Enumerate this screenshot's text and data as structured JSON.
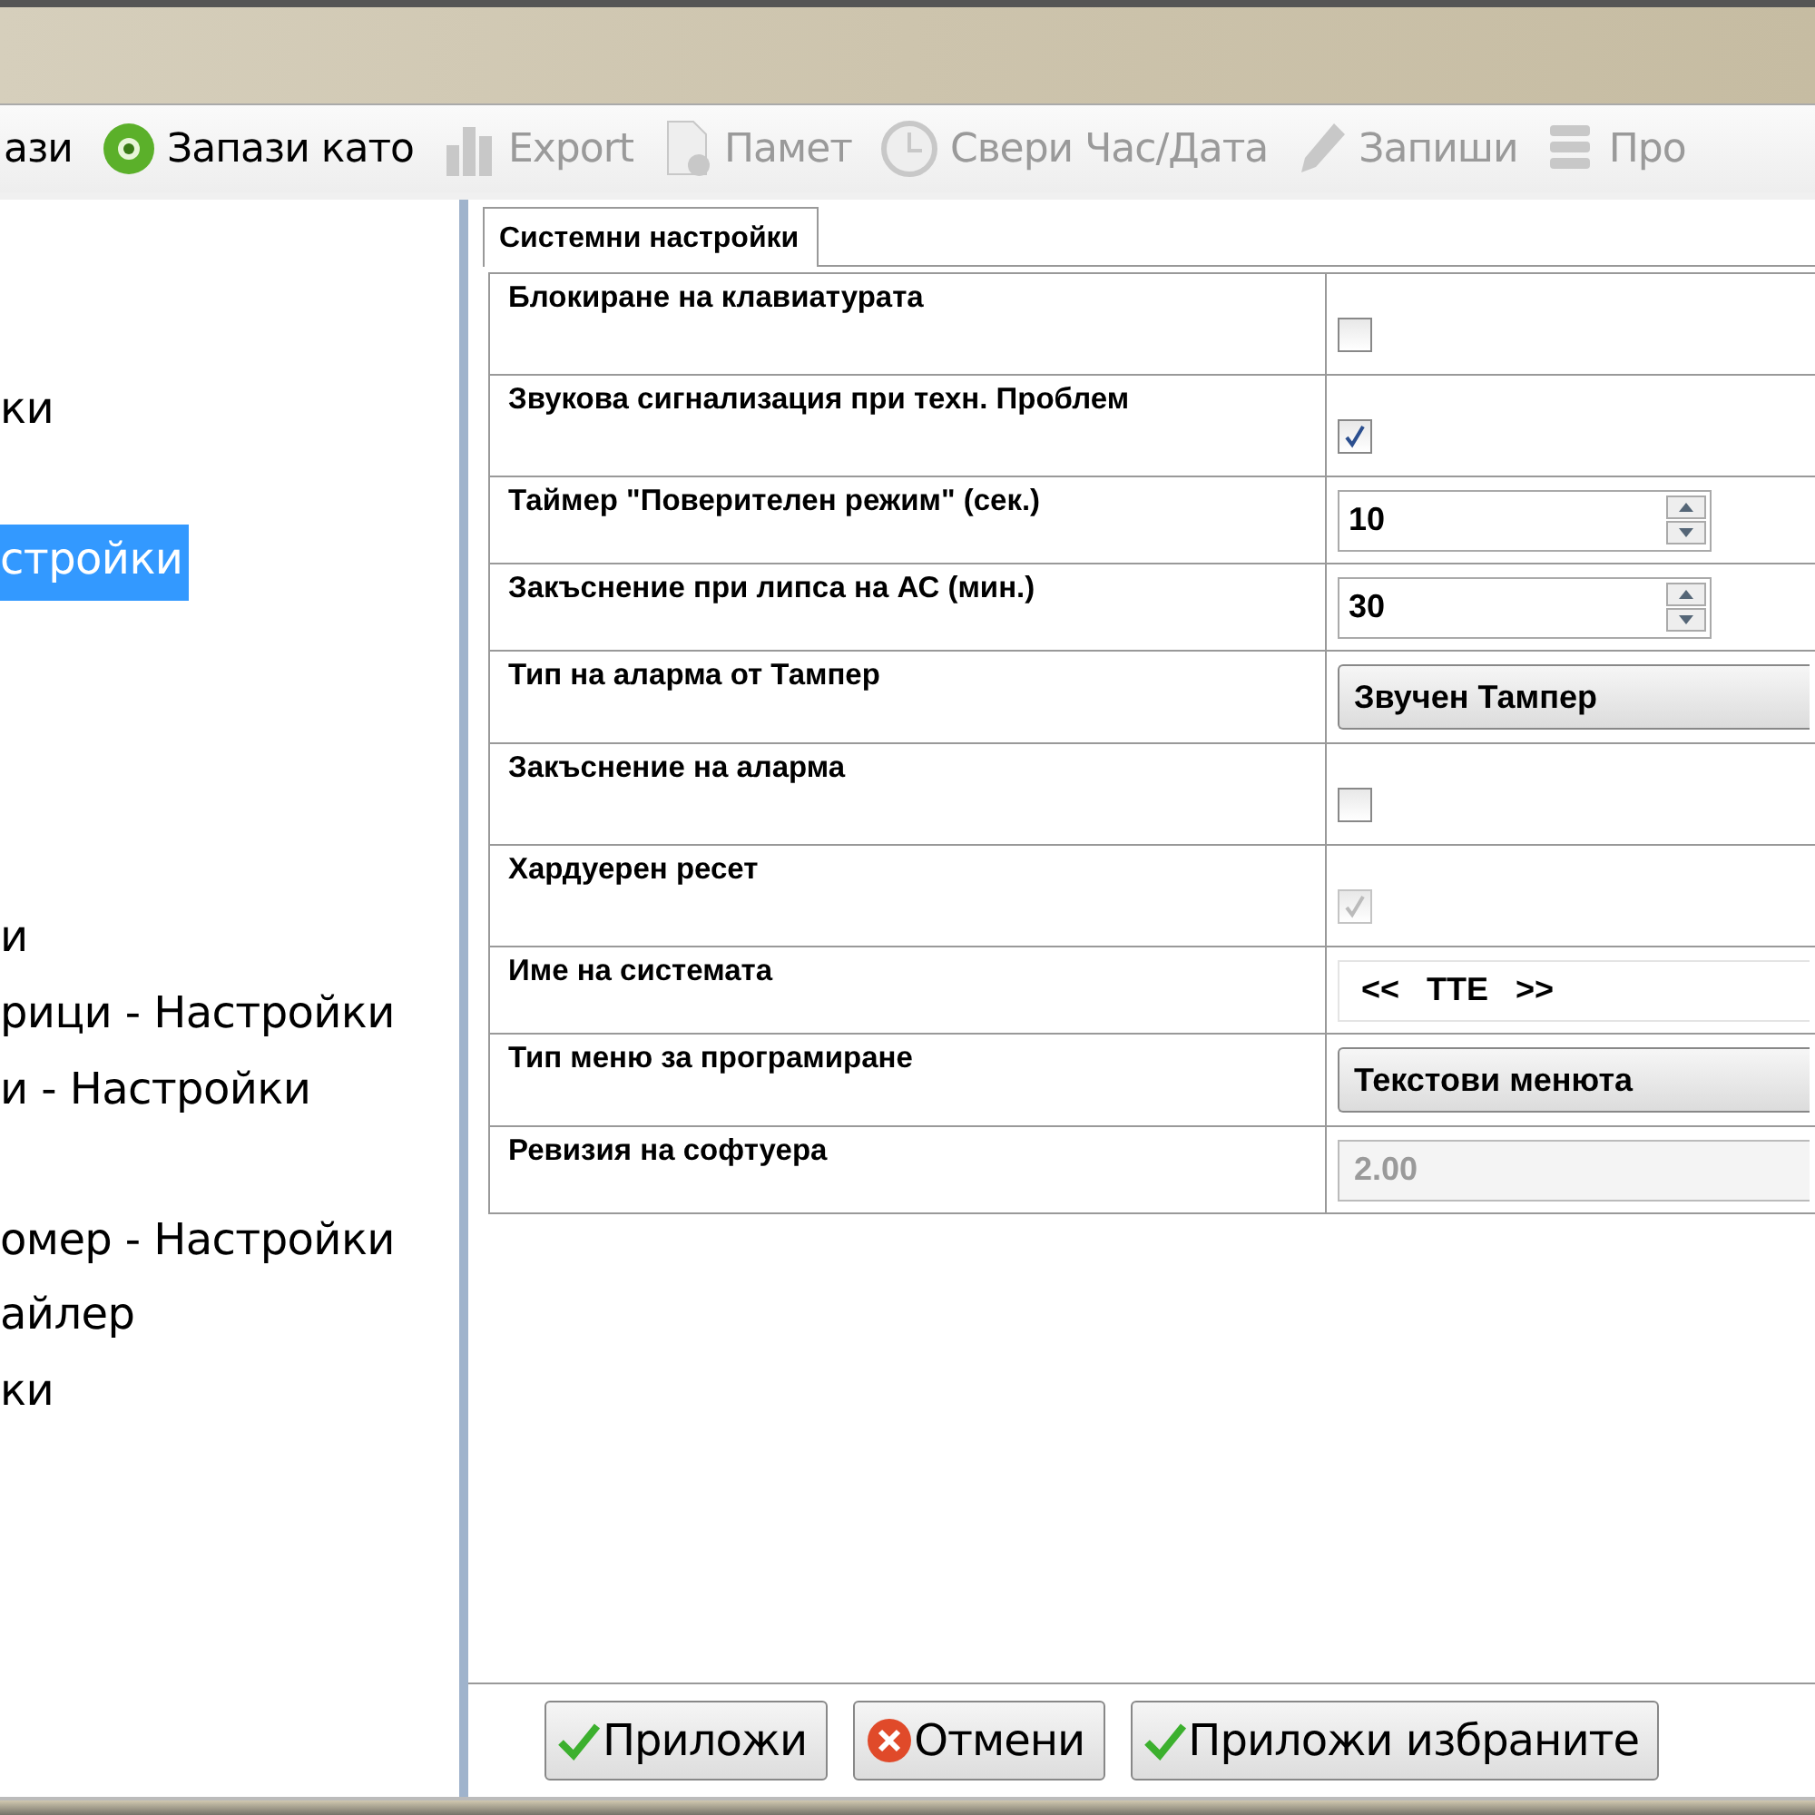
{
  "toolbar": [
    {
      "label": "ази",
      "disabled": false,
      "kind": "none"
    },
    {
      "label": "Запази като",
      "disabled": false,
      "kind": "ring"
    },
    {
      "label": "Export",
      "disabled": true,
      "kind": "bars"
    },
    {
      "label": "Памет",
      "disabled": true,
      "kind": "doc"
    },
    {
      "label": "Свери Час/Дата",
      "disabled": true,
      "kind": "clock"
    },
    {
      "label": "Запиши",
      "disabled": true,
      "kind": "pencil"
    },
    {
      "label": "Про",
      "disabled": true,
      "kind": "stack"
    }
  ],
  "tree": [
    {
      "label": "ки",
      "selected": false
    },
    {
      "label": "стройки",
      "selected": true
    },
    {
      "label": "и",
      "selected": false
    },
    {
      "label": "рици - Настройки",
      "selected": false
    },
    {
      "label": "и - Настройки",
      "selected": false
    },
    {
      "label": "омер - Настройки",
      "selected": false
    },
    {
      "label": "айлер",
      "selected": false
    },
    {
      "label": "ки",
      "selected": false
    }
  ],
  "tab": {
    "label": "Системни настройки",
    "selected": true
  },
  "settings": [
    {
      "label": "Блокиране на клавиатурата",
      "kind": "checkbox",
      "checked": false,
      "disabled": false
    },
    {
      "label": "Звукова сигнализация при техн. Проблем",
      "kind": "checkbox",
      "checked": true,
      "disabled": false
    },
    {
      "label": "Таймер \"Поверителен режим\" (сек.)",
      "kind": "spinner",
      "value": "10"
    },
    {
      "label": "Закъснение при липса на АС (мин.)",
      "kind": "spinner",
      "value": "30"
    },
    {
      "label": "Тип на аларма от Тампер",
      "kind": "dropdown",
      "value": "Звучен Тампер"
    },
    {
      "label": "Закъснение на аларма",
      "kind": "checkbox",
      "checked": false,
      "disabled": false
    },
    {
      "label": "Хардуерен ресет",
      "kind": "checkbox",
      "checked": true,
      "disabled": true
    },
    {
      "label": "Име на системата",
      "kind": "text",
      "value": "<<   TTE   >>"
    },
    {
      "label": "Тип меню за програмиране",
      "kind": "dropdown",
      "value": "Текстови менюта"
    },
    {
      "label": "Ревизия на софтуера",
      "kind": "readonly",
      "value": "2.00"
    }
  ],
  "buttons": [
    {
      "label": "Приложи",
      "kind": "check"
    },
    {
      "label": "Отмени",
      "kind": "cancel"
    },
    {
      "label": "Приложи избраните",
      "kind": "check"
    }
  ]
}
